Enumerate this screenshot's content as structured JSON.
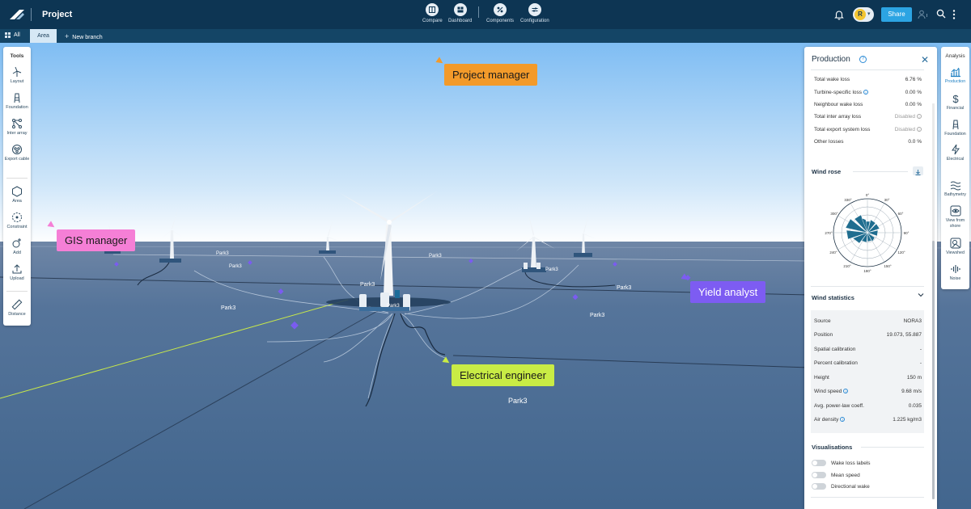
{
  "topbar": {
    "project_title": "Project",
    "nav": [
      {
        "label": "Compare"
      },
      {
        "label": "Dashboard"
      },
      {
        "label": "Components"
      },
      {
        "label": "Configuration"
      }
    ],
    "avatar_initial": "R",
    "share_label": "Share"
  },
  "branchbar": {
    "all_label": "All",
    "area_label": "Area",
    "new_branch_label": "New branch"
  },
  "tools": {
    "title": "Tools",
    "items": [
      {
        "label": "Layout"
      },
      {
        "label": "Foundation"
      },
      {
        "label": "Inter array"
      },
      {
        "label": "Export cable"
      },
      {
        "label": "Area"
      },
      {
        "label": "Constraint"
      },
      {
        "label": "Add"
      },
      {
        "label": "Upload"
      },
      {
        "label": "Distance"
      }
    ]
  },
  "analysis": {
    "title": "Analysis",
    "items": [
      {
        "label": "Production"
      },
      {
        "label": "Financial"
      },
      {
        "label": "Foundation"
      },
      {
        "label": "Electrical"
      },
      {
        "label": "Bathymetry"
      },
      {
        "label": "View from shore"
      },
      {
        "label": "Viewshed"
      },
      {
        "label": "Noise"
      }
    ]
  },
  "production": {
    "title": "Production",
    "losses": [
      {
        "label": "Total wake loss",
        "value": "6.76 %"
      },
      {
        "label": "Turbine-specific loss",
        "value": "0.00 %"
      },
      {
        "label": "Neighbour wake loss",
        "value": "0.00 %"
      },
      {
        "label": "Total inter array loss",
        "value": "Disabled"
      },
      {
        "label": "Total export system loss",
        "value": "Disabled"
      },
      {
        "label": "Other losses",
        "value": "0.0 %"
      }
    ],
    "wind_rose_title": "Wind rose",
    "wind_rose_angles": [
      "0°",
      "30°",
      "60°",
      "90°",
      "120°",
      "150°",
      "180°",
      "210°",
      "240°",
      "270°",
      "300°",
      "330°"
    ],
    "wind_statistics_title": "Wind statistics",
    "stats": [
      {
        "label": "Source",
        "value": "NORA3"
      },
      {
        "label": "Position",
        "value": "19.073, 55.887"
      },
      {
        "label": "Spatial calibration",
        "value": "-"
      },
      {
        "label": "Percent calibration",
        "value": "-"
      },
      {
        "label": "Height",
        "value": "150 m"
      },
      {
        "label": "Wind speed",
        "value": "9.68 m/s"
      },
      {
        "label": "Avg. power-law coeff.",
        "value": "0.035"
      },
      {
        "label": "Air density",
        "value": "1.225 kg/m3"
      }
    ],
    "visualisations_title": "Visualisations",
    "toggles": [
      {
        "label": "Wake loss labels"
      },
      {
        "label": "Mean speed"
      },
      {
        "label": "Directional wake"
      }
    ]
  },
  "roles": {
    "project_manager": "Project manager",
    "gis_manager": "GIS manager",
    "yield_analyst": "Yield analyst",
    "electrical_engineer": "Electrical engineer"
  },
  "scene_labels": [
    "Park3",
    "Park3",
    "Park3",
    "Park3",
    "Park3",
    "Park3",
    "Park3",
    "Park3",
    "Park3",
    "Park3"
  ],
  "colors": {
    "topbar": "#0d3553",
    "accent": "#2ca4e3",
    "project_manager": "#f39a2a",
    "gis_manager": "#f57fd6",
    "yield_analyst": "#7d5cf2",
    "electrical_engineer": "#c9ec45"
  }
}
